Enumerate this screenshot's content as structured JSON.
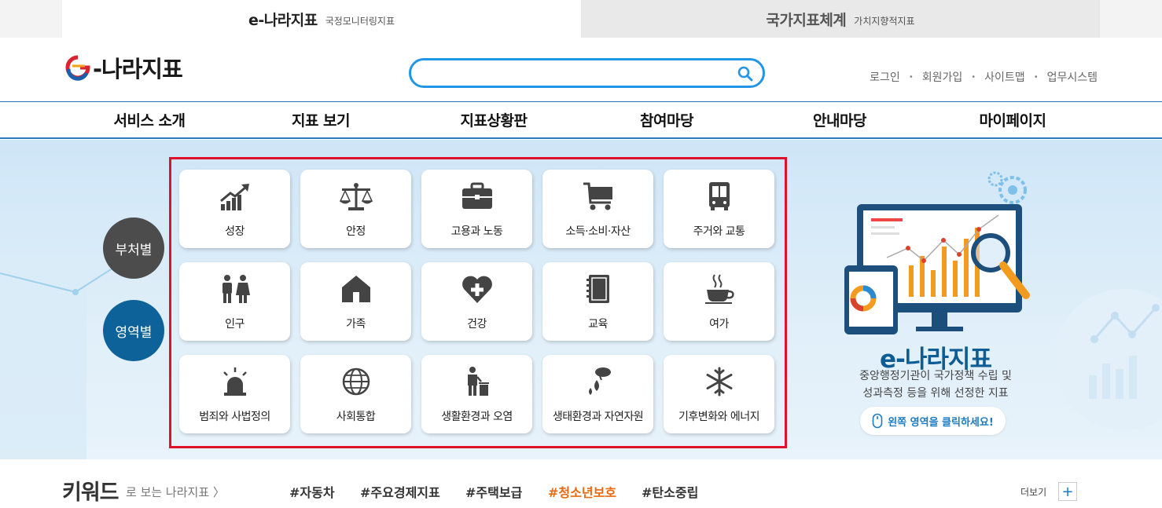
{
  "top_tabs": [
    {
      "main": "e-나라지표",
      "sub": "국정모니터링지표"
    },
    {
      "main": "국가지표체계",
      "sub": "가치지향적지표"
    }
  ],
  "header": {
    "logo_text": "-나라지표",
    "search_placeholder": "",
    "util": [
      "로그인",
      "회원가입",
      "사이트맵",
      "업무시스템"
    ]
  },
  "gnb": [
    "서비스 소개",
    "지표 보기",
    "지표상황판",
    "참여마당",
    "안내마당",
    "마이페이지"
  ],
  "side_buttons": [
    "부처별",
    "영역별"
  ],
  "categories": [
    {
      "label": "성장",
      "icon": "growth-chart-icon"
    },
    {
      "label": "안정",
      "icon": "scale-icon"
    },
    {
      "label": "고용과 노동",
      "icon": "briefcase-icon"
    },
    {
      "label": "소득·소비·자산",
      "icon": "cart-icon"
    },
    {
      "label": "주거와 교통",
      "icon": "bus-icon"
    },
    {
      "label": "인구",
      "icon": "people-icon"
    },
    {
      "label": "가족",
      "icon": "house-icon"
    },
    {
      "label": "건강",
      "icon": "heart-plus-icon"
    },
    {
      "label": "교육",
      "icon": "notebook-icon"
    },
    {
      "label": "여가",
      "icon": "coffee-cup-icon"
    },
    {
      "label": "범죄와 사법정의",
      "icon": "siren-icon"
    },
    {
      "label": "사회통합",
      "icon": "globe-icon"
    },
    {
      "label": "생활환경과 오염",
      "icon": "trash-person-icon"
    },
    {
      "label": "생태환경과 자연자원",
      "icon": "water-drop-icon"
    },
    {
      "label": "기후변화와 에너지",
      "icon": "snowflake-icon"
    }
  ],
  "promo": {
    "title": "e-나라지표",
    "desc_line1": "중앙행정기관이 국가정책 수립 및",
    "desc_line2": "성과측정 등을 위해 선정한 지표",
    "button": "왼쪽 영역을 클릭하세요!"
  },
  "keywords": {
    "title": "키워드",
    "sub": "로 보는 나라지표 〉",
    "tags": [
      "#자동차",
      "#주요경제지표",
      "#주택보급",
      "#청소년보호",
      "#탄소중립"
    ],
    "highlight_index": 3,
    "more": "더보기",
    "more_symbol": "+"
  },
  "colors": {
    "accent": "#2196e6",
    "highlight_border": "#e0112b",
    "keyword_highlight": "#e96a10",
    "side_dark": "#4c4c4c",
    "side_blue": "#0d6399"
  }
}
